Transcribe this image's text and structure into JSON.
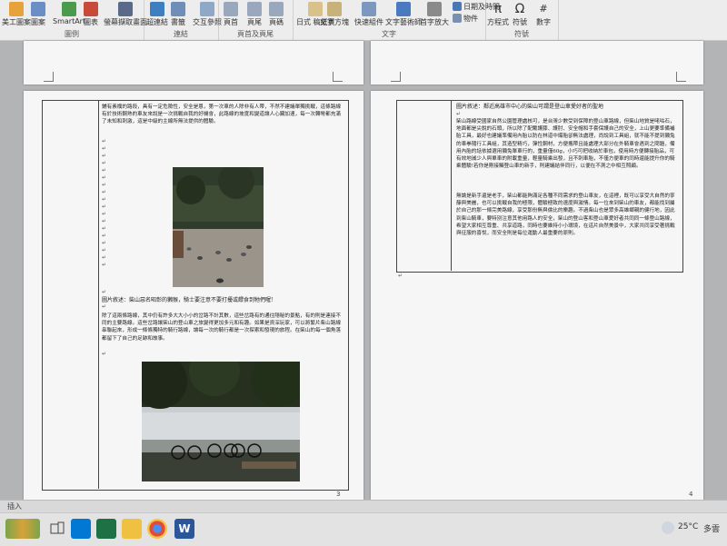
{
  "ribbon": {
    "groups": [
      {
        "label": "圖例",
        "buttons": [
          "美工圖案",
          "圖案",
          "SmartArt",
          "圖表",
          "螢幕擷取畫面"
        ]
      },
      {
        "label": "連結",
        "buttons": [
          "超連結",
          "書籤",
          "交互參照"
        ]
      },
      {
        "label": "頁首及頁尾",
        "buttons": [
          "頁首",
          "頁尾",
          "頁碼"
        ]
      },
      {
        "label": "文字",
        "buttons": [
          "文字方塊",
          "快速組件",
          "文字藝術師",
          "首字放大",
          "日期及時間",
          "物件"
        ]
      },
      {
        "label": "符號",
        "buttons": [
          "方程式",
          "符號",
          "數字"
        ]
      }
    ],
    "extra": {
      "text_box_label": "日式 稿紙頁",
      "date_label": "日期及時間"
    }
  },
  "page_left": {
    "para1": "鋪有素樸的路段，具有一定危險性，安全是恩，第一次車的人除非有人帶，不然不建議單獨挑戰，這條路線有於技術鋼熟的車友來說是一次挑戰自我的好機會，此路線的坡度和變道讓人心臟加速，每一次轉彎都充滿了未知和刺激，這是中級的主線所無法提供的體驗。",
    "caption1": "圖片敘述：柴山惡名昭彰的獺猴，騎士要注意不要打擾或餵食到牠們喔!",
    "para2": "除了這兩條路線，其中仍有許多大大小小的岔路不計其數，這些岔路有的通往隱秘的景點，有的則是連接不同的主要路線。這些岔路讓柴山的登山車之旅變得更加多元和有趣。如果是資深玩家，可以將繁片柴山路線串聯起來，形成一條條獨特的騎行路線，讓每一次的騎行都是一次探索和發現的旅程。在柴山的每一個角落都留下了自己的足跡和故事。",
    "page_number": "3"
  },
  "page_right": {
    "caption_top": "圖片敘述：鄰近高雄市中心的柴山可謂是登山車愛好者的聖地",
    "para1": "柴山路線受國家自然公園管理處核可，是台灣少數受到保障的登山車路線，但柴山地質是咾咕石，地面都是尖銳的石頭，所以除了配戴護膝、護肘、安全帽和手套保護自己的安全，上山更要準備補胎工具，最好也建議準備用內胎以防在林道中爆胎卻無法處理，尚說到工具組，就不能不提到獺兔的車拳隨行工具組，其造型精巧，彈性鋼材，方便攜帶且能處理大部分在外騎車會遇到之問題，備用內胎的話依據選用獺兔單車行的，重量僅60g，小巧可把收納於車包，使用時方便轉接胎品，可有效地減少人與單車的附載重量，輕量騎乘出發，且不刺車胎，不僅方便車的同時還能提升你的騎乘體驗!若你是剛接觸登山車的新手，則建議結伴同行，以便在不測之中相互照顧。",
    "para2": "無論是新手還是老手，柴山都能夠滿足各種不同需求的登山車友，在這裡，既可以享受大自然的寧靜與美麗，也可以挑戰自我的極限，體驗極致的速度與激情。每一位來到柴山的車友，都能找到屬於自己的那一條完美路線，享受那份無與倫比的樂趣。不過柴山也是眾多高雄鄉親的健行地，因此到柴山騎車，要特別注意其他用路人的安全，柴山的登山客和登山車愛好者共同同一條登山路線，希望大家相互尊重、共享道路，同時也要維持小小環境，在這片自然美景中，大家共同享受著挑戰與征服的喜悅，而安全則是每位運動人最重要的原則。",
    "page_number": "4"
  },
  "status_bar": {
    "mode": "插入"
  },
  "taskbar": {
    "temperature": "25°C",
    "weather": "多雲"
  },
  "colors": {
    "accent_word": "#2b579a",
    "excel": "#1e7145",
    "store": "#0078d4"
  }
}
